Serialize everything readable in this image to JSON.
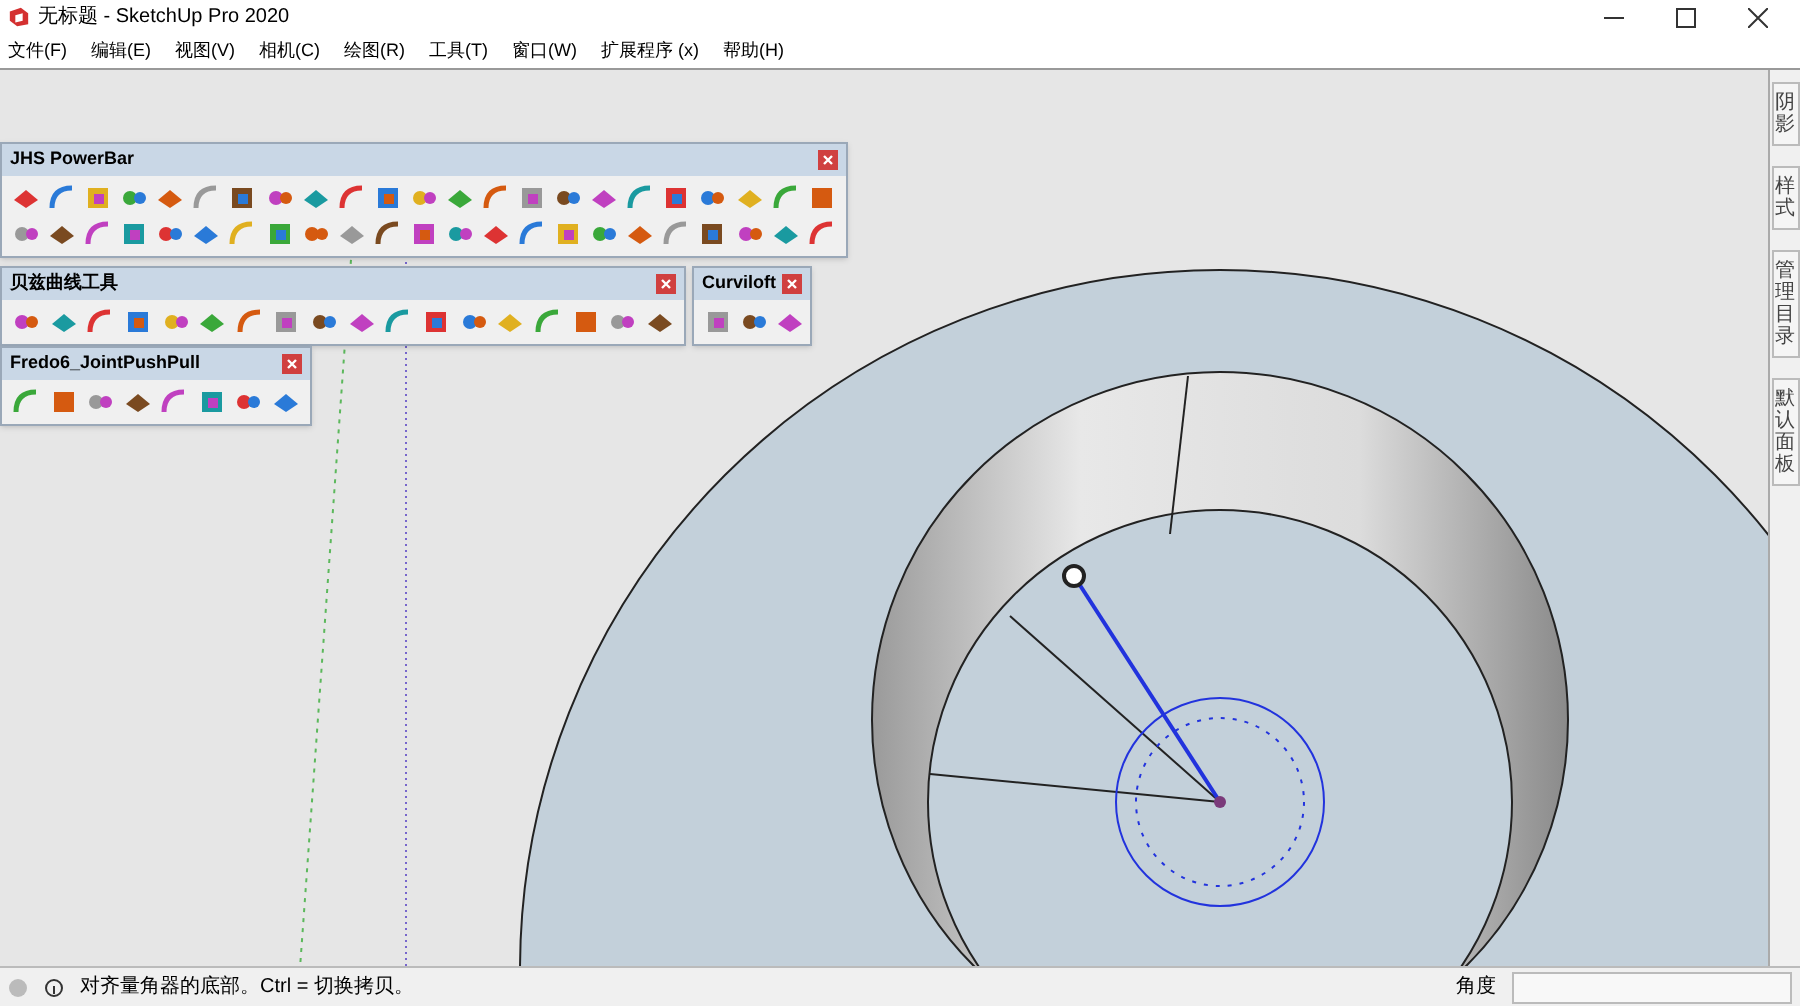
{
  "window": {
    "title": "无标题 - SketchUp Pro 2020"
  },
  "menu": [
    "文件(F)",
    "编辑(E)",
    "视图(V)",
    "相机(C)",
    "绘图(R)",
    "工具(T)",
    "窗口(W)",
    "扩展程序 (x)",
    "帮助(H)"
  ],
  "toolbars": [
    {
      "title": "JHS PowerBar",
      "kind": "jhs"
    },
    {
      "title": "贝兹曲线工具",
      "kind": "bezier"
    },
    {
      "title": "Curviloft",
      "kind": "curviloft"
    },
    {
      "title": "Fredo6_JointPushPull",
      "kind": "fredo"
    }
  ],
  "tray_tabs": [
    "阴影",
    "样式",
    "管理目录",
    "默认面板"
  ],
  "status_bar": {
    "message": "对齐量角器的底部。Ctrl = 切换拷贝。",
    "measure_label": "角度"
  }
}
